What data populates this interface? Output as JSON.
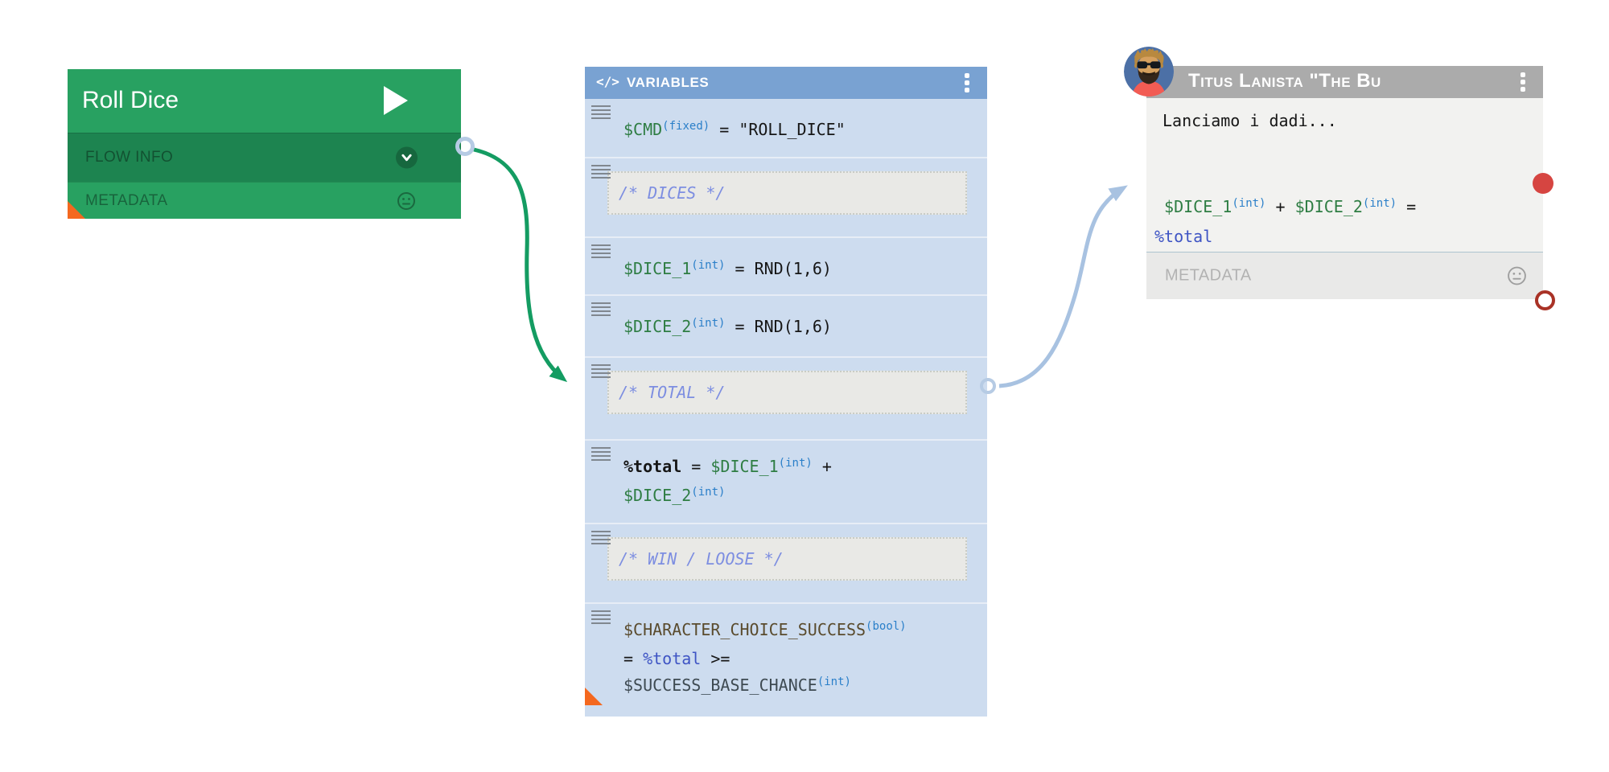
{
  "roll_dice_node": {
    "title": "Roll Dice",
    "flow_info_label": "FLOW INFO",
    "metadata_label": "METADATA"
  },
  "variables_node": {
    "title": "VARIABLES",
    "rows": [
      {
        "kind": "code",
        "segments": [
          {
            "text": "$CMD",
            "style": "green"
          },
          {
            "text": "(fixed)",
            "style": "type"
          },
          {
            "text": " = ",
            "style": "plain"
          },
          {
            "text": "\"ROLL_DICE\"",
            "style": "plain"
          }
        ]
      },
      {
        "kind": "comment",
        "text": "/* DICES */"
      },
      {
        "kind": "code",
        "segments": [
          {
            "text": "$DICE_1",
            "style": "green"
          },
          {
            "text": "(int)",
            "style": "type"
          },
          {
            "text": " = ",
            "style": "plain"
          },
          {
            "text": "RND(1,6)",
            "style": "plain"
          }
        ]
      },
      {
        "kind": "code",
        "segments": [
          {
            "text": "$DICE_2",
            "style": "green"
          },
          {
            "text": "(int)",
            "style": "type"
          },
          {
            "text": " = ",
            "style": "plain"
          },
          {
            "text": "RND(1,6)",
            "style": "plain"
          }
        ]
      },
      {
        "kind": "comment",
        "text": "/* TOTAL */"
      },
      {
        "kind": "code",
        "segments": [
          {
            "text": "%total",
            "style": "bold"
          },
          {
            "text": " = ",
            "style": "plain"
          },
          {
            "text": "$DICE_1",
            "style": "green"
          },
          {
            "text": "(int)",
            "style": "type"
          },
          {
            "text": " +",
            "style": "plain"
          },
          {
            "br": true
          },
          {
            "text": "$DICE_2",
            "style": "green"
          },
          {
            "text": "(int)",
            "style": "type"
          }
        ]
      },
      {
        "kind": "comment",
        "text": "/* WIN / LOOSE */"
      },
      {
        "kind": "code",
        "segments": [
          {
            "text": "$CHARACTER_CHOICE_SUCCESS",
            "style": "olive"
          },
          {
            "text": "(bool)",
            "style": "type"
          },
          {
            "br": true
          },
          {
            "text": "= ",
            "style": "plain"
          },
          {
            "text": "%total",
            "style": "indigo"
          },
          {
            "text": " >=",
            "style": "plain"
          },
          {
            "br": true
          },
          {
            "text": "$SUCCESS_BASE_CHANCE",
            "style": "slate"
          },
          {
            "text": "(int)",
            "style": "type"
          }
        ]
      }
    ]
  },
  "character_node": {
    "title": "Titus Lanista \"The Bu",
    "message": "Lanciamo i dadi...",
    "code": [
      {
        "text": " $DICE_1",
        "style": "green"
      },
      {
        "text": "(int)",
        "style": "type"
      },
      {
        "text": " + ",
        "style": "plain"
      },
      {
        "text": "$DICE_2",
        "style": "green"
      },
      {
        "text": "(int)",
        "style": "type"
      },
      {
        "text": " = ",
        "style": "plain"
      },
      {
        "br": true
      },
      {
        "text": "%total",
        "style": "indigo"
      }
    ],
    "metadata_label": "METADATA"
  },
  "icons": {
    "code": "</>",
    "play": "play-triangle",
    "kebab": "kebab-menu",
    "chevron": "chevron-down",
    "smiley": "neutral-face"
  },
  "colors": {
    "node_green": "#28a161",
    "node_green_dark": "#1d8450",
    "variables_header": "#79a2d2",
    "variables_row": "#cddcef",
    "character_header": "#ababab",
    "wire_green": "#149c62",
    "wire_blue": "#a8c2e1",
    "corner_flag": "#f4681f",
    "red_dot": "#d64541",
    "red_ring": "#a93226",
    "comment_text": "#7d8ee1",
    "code_var_green": "#2e7d43",
    "code_type_blue": "#2a7fc9",
    "code_indigo": "#3e54c4",
    "code_olive": "#5a4b2d",
    "code_slate": "#3e4a52"
  }
}
